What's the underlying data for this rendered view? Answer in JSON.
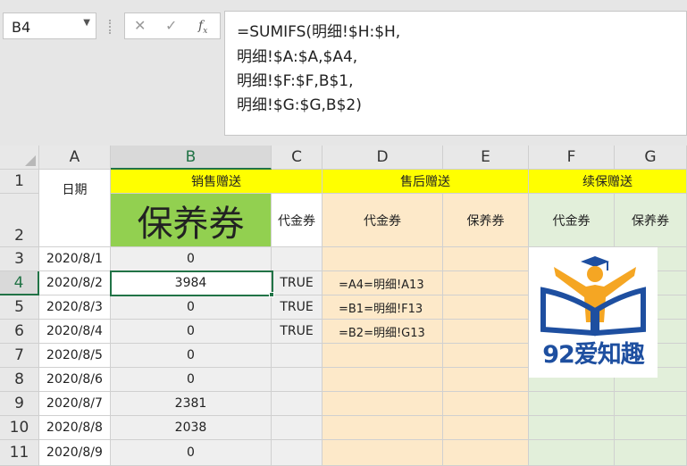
{
  "name_box": {
    "value": "B4"
  },
  "formula_bar": {
    "icons": [
      "cancel-icon",
      "enter-icon",
      "fx-icon"
    ],
    "lines": [
      "=SUMIFS(明细!$H:$H,",
      "明细!$A:$A,$A4,",
      "明细!$F:$F,B$1,",
      "明细!$G:$G,B$2)"
    ]
  },
  "columns": [
    "A",
    "B",
    "C",
    "D",
    "E",
    "F",
    "G"
  ],
  "rows": [
    "1",
    "2",
    "3",
    "4",
    "5",
    "6",
    "7",
    "8",
    "9",
    "10",
    "11"
  ],
  "header_row1": {
    "b": "销售赠送",
    "d": "售后赠送",
    "f": "续保赠送"
  },
  "header_row2": {
    "a": "日期",
    "b": "保养券",
    "c": "代金券",
    "d": "代金券",
    "e": "保养券",
    "f": "代金券",
    "g": "保养券"
  },
  "data": [
    {
      "date": "2020/8/1",
      "b": "0",
      "c": "",
      "d": ""
    },
    {
      "date": "2020/8/2",
      "b": "3984",
      "c": "TRUE",
      "d": "=A4=明细!A13"
    },
    {
      "date": "2020/8/3",
      "b": "0",
      "c": "TRUE",
      "d": "=B1=明细!F13"
    },
    {
      "date": "2020/8/4",
      "b": "0",
      "c": "TRUE",
      "d": "=B2=明细!G13"
    },
    {
      "date": "2020/8/5",
      "b": "0",
      "c": "",
      "d": ""
    },
    {
      "date": "2020/8/6",
      "b": "0",
      "c": "",
      "d": ""
    },
    {
      "date": "2020/8/7",
      "b": "2381",
      "c": "",
      "d": ""
    },
    {
      "date": "2020/8/8",
      "b": "2038",
      "c": "",
      "d": ""
    },
    {
      "date": "2020/8/9",
      "b": "0",
      "c": "",
      "d": ""
    }
  ],
  "logo": {
    "text": "92爱知趣"
  },
  "colors": {
    "yellow": "#ffff00",
    "green": "#92d050",
    "peach": "#fde9c9",
    "mint": "#e2efda",
    "selection": "#217346"
  }
}
